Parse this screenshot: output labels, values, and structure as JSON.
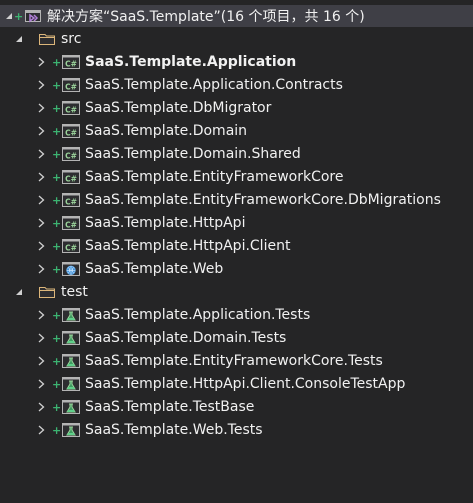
{
  "solution": {
    "label": "解决方案“SaaS.Template”(16 个项目，共 16 个)",
    "icon": "solution-icon"
  },
  "folders": [
    {
      "name": "src",
      "icon": "folder-icon",
      "expanded": true,
      "projects": [
        {
          "label": "SaaS.Template.Application",
          "icon": "csharp-project-icon",
          "bold": true
        },
        {
          "label": "SaaS.Template.Application.Contracts",
          "icon": "csharp-project-icon"
        },
        {
          "label": "SaaS.Template.DbMigrator",
          "icon": "csharp-project-icon"
        },
        {
          "label": "SaaS.Template.Domain",
          "icon": "csharp-project-icon"
        },
        {
          "label": "SaaS.Template.Domain.Shared",
          "icon": "csharp-project-icon"
        },
        {
          "label": "SaaS.Template.EntityFrameworkCore",
          "icon": "csharp-project-icon"
        },
        {
          "label": "SaaS.Template.EntityFrameworkCore.DbMigrations",
          "icon": "csharp-project-icon"
        },
        {
          "label": "SaaS.Template.HttpApi",
          "icon": "csharp-project-icon"
        },
        {
          "label": "SaaS.Template.HttpApi.Client",
          "icon": "csharp-project-icon"
        },
        {
          "label": "SaaS.Template.Web",
          "icon": "web-project-icon"
        }
      ]
    },
    {
      "name": "test",
      "icon": "folder-icon",
      "expanded": true,
      "projects": [
        {
          "label": "SaaS.Template.Application.Tests",
          "icon": "test-project-icon"
        },
        {
          "label": "SaaS.Template.Domain.Tests",
          "icon": "test-project-icon"
        },
        {
          "label": "SaaS.Template.EntityFrameworkCore.Tests",
          "icon": "test-project-icon"
        },
        {
          "label": "SaaS.Template.HttpApi.Client.ConsoleTestApp",
          "icon": "test-project-icon"
        },
        {
          "label": "SaaS.Template.TestBase",
          "icon": "test-project-icon"
        },
        {
          "label": "SaaS.Template.Web.Tests",
          "icon": "test-project-icon"
        }
      ]
    }
  ],
  "colors": {
    "background": "#252526",
    "selected": "#3f3f46",
    "text": "#f1f1f1",
    "folder": "#dcb67a",
    "csharp": "#9bd39b",
    "added": "#3cb371"
  }
}
